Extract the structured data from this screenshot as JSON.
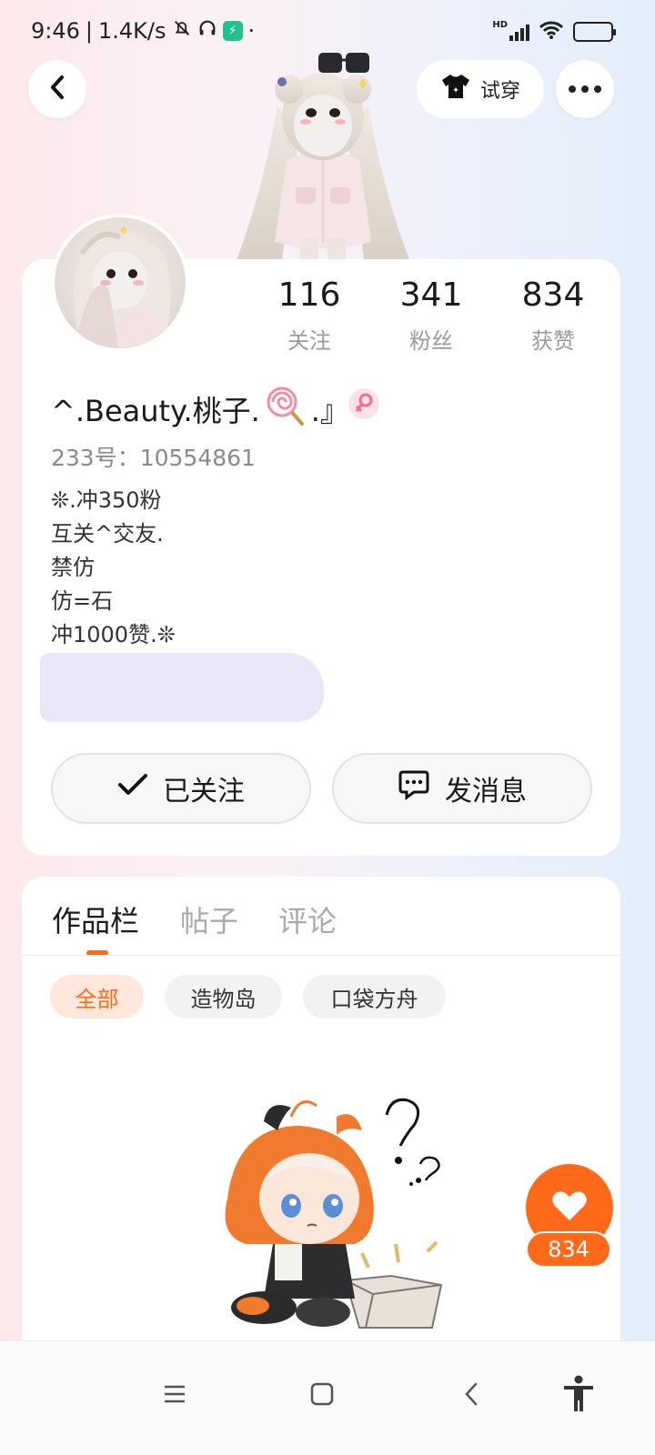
{
  "status_bar": {
    "time": "9:46",
    "network_speed": "1.4K/s",
    "separator": "|",
    "dot": "·",
    "hd_label": "HD"
  },
  "header": {
    "try_on_label": "试穿"
  },
  "profile": {
    "stats": [
      {
        "value": "116",
        "label": "关注"
      },
      {
        "value": "341",
        "label": "粉丝"
      },
      {
        "value": "834",
        "label": "获赞"
      }
    ],
    "nickname": "^.Beauty.桃子.",
    "nickname_suffix": ".』",
    "gender_icon": "female-icon",
    "uid": "233号：10554861",
    "bio_lines": [
      "❊.冲350粉",
      "互关^交友.",
      "禁仿",
      "仿=石",
      "冲1000赞.❊"
    ],
    "follow_label": "已关注",
    "message_label": "发消息"
  },
  "content": {
    "tabs": [
      "作品栏",
      "帖子",
      "评论"
    ],
    "active_tab": 0,
    "chips": [
      "全部",
      "造物岛",
      "口袋方舟"
    ],
    "active_chip": 0
  },
  "like_fab": {
    "count": "834"
  },
  "colors": {
    "accent": "#ff6a1a",
    "chip_active_bg": "#ffe7dc",
    "gender_pink": "#f46b91"
  }
}
